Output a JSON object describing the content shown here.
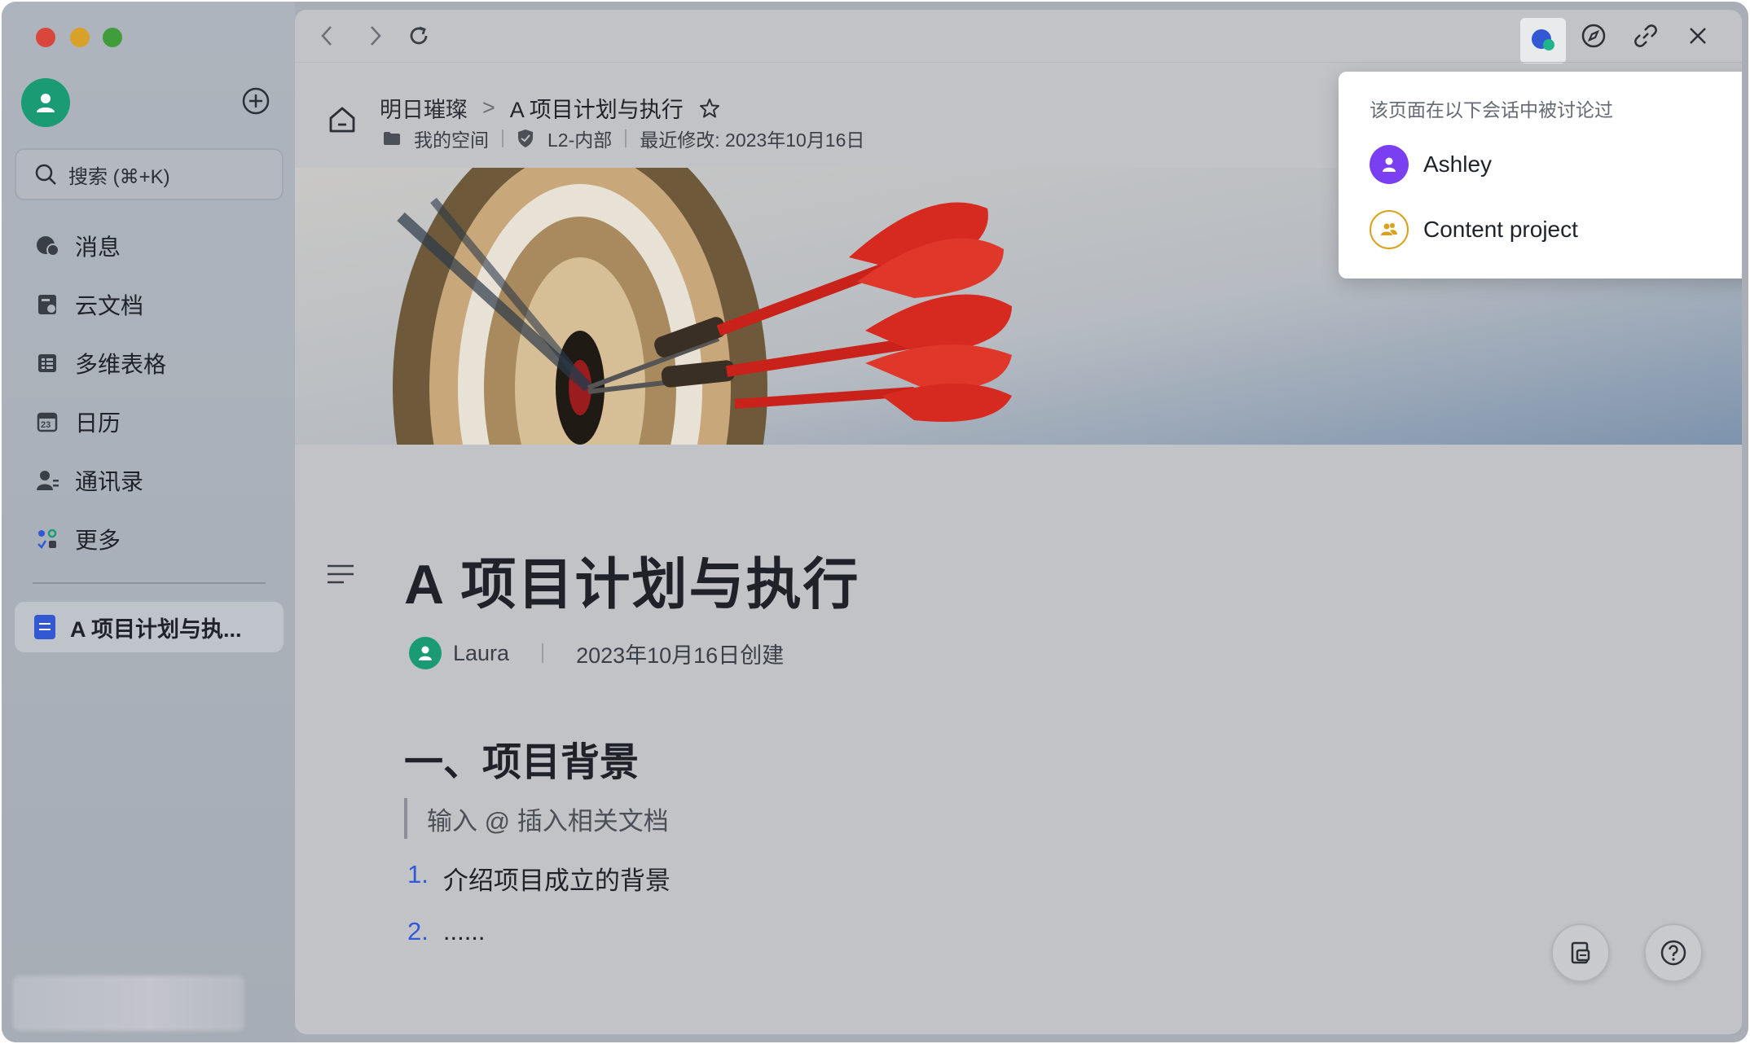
{
  "sidebar": {
    "search_placeholder": "搜索 (⌘+K)",
    "items": [
      {
        "label": "消息",
        "icon": "chat-bubble-icon"
      },
      {
        "label": "云文档",
        "icon": "cloud-doc-icon"
      },
      {
        "label": "多维表格",
        "icon": "table-grid-icon"
      },
      {
        "label": "日历",
        "icon": "calendar-icon"
      },
      {
        "label": "通讯录",
        "icon": "contacts-icon"
      },
      {
        "label": "更多",
        "icon": "apps-grid-icon"
      }
    ],
    "calendar_day": "23",
    "recent_doc": "A 项目计划与执..."
  },
  "header": {
    "workspace": "明日璀璨",
    "breadcrumb_sep": ">",
    "doc_title": "A 项目计划与执行",
    "location": "我的空间",
    "security": "L2-内部",
    "last_modified": "最近修改: 2023年10月16日"
  },
  "document": {
    "title": "A 项目计划与执行",
    "author": "Laura",
    "created": "2023年10月16日创建",
    "section_title": "一、项目背景",
    "quote_hint": "输入 @ 插入相关文档",
    "list": [
      {
        "num": "1.",
        "text": "介绍项目成立的背景"
      },
      {
        "num": "2.",
        "text": "......"
      }
    ]
  },
  "popup": {
    "heading": "该页面在以下会话中被讨论过",
    "items": [
      {
        "name": "Ashley",
        "type": "person"
      },
      {
        "name": "Content project",
        "type": "group"
      }
    ]
  },
  "colors": {
    "accent_blue": "#3358d4",
    "avatar_green": "#1a9b74",
    "ashley_purple": "#7b3ff2",
    "group_gold": "#d9a21b",
    "list_number_blue": "#2f59d8"
  }
}
